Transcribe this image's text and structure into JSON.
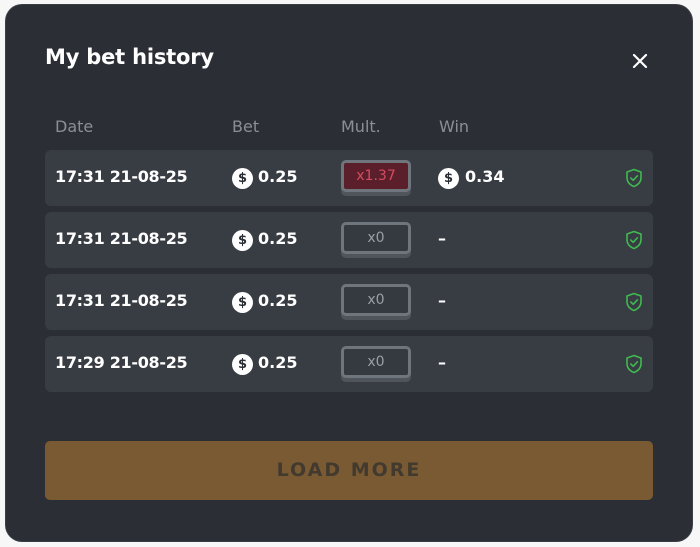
{
  "modal": {
    "title": "My bet history",
    "close_icon": "close-icon"
  },
  "table": {
    "headers": [
      "Date",
      "Bet",
      "Mult.",
      "Win"
    ],
    "rows": [
      {
        "date": "17:31 21-08-25",
        "bet": "0.25",
        "mult": "x1.37",
        "win": "0.34",
        "won": true
      },
      {
        "date": "17:31 21-08-25",
        "bet": "0.25",
        "mult": "x0",
        "win": "–",
        "won": false
      },
      {
        "date": "17:31 21-08-25",
        "bet": "0.25",
        "mult": "x0",
        "win": "–",
        "won": false
      },
      {
        "date": "17:29 21-08-25",
        "bet": "0.25",
        "mult": "x0",
        "win": "–",
        "won": false
      }
    ],
    "coin_symbol": "$",
    "verified_icon": "shield-check-icon"
  },
  "load_more_label": "LOAD MORE",
  "colors": {
    "background": "#2b2f35",
    "row": "#383c43",
    "win_mult_bg": "#5a1f2b",
    "win_mult_text": "#d64b5f",
    "verified": "#3fb950",
    "load_more_bg": "#7a5a33"
  }
}
